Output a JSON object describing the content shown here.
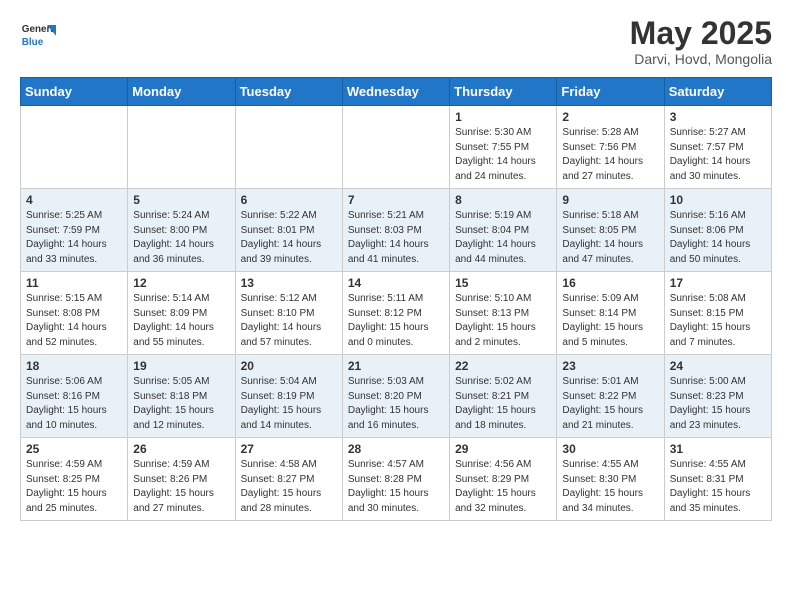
{
  "header": {
    "logo_general": "General",
    "logo_blue": "Blue",
    "title": "May 2025",
    "location": "Darvi, Hovd, Mongolia"
  },
  "weekdays": [
    "Sunday",
    "Monday",
    "Tuesday",
    "Wednesday",
    "Thursday",
    "Friday",
    "Saturday"
  ],
  "weeks": [
    [
      {
        "day": "",
        "sunrise": "",
        "sunset": "",
        "daylight": ""
      },
      {
        "day": "",
        "sunrise": "",
        "sunset": "",
        "daylight": ""
      },
      {
        "day": "",
        "sunrise": "",
        "sunset": "",
        "daylight": ""
      },
      {
        "day": "",
        "sunrise": "",
        "sunset": "",
        "daylight": ""
      },
      {
        "day": "1",
        "sunrise": "Sunrise: 5:30 AM",
        "sunset": "Sunset: 7:55 PM",
        "daylight": "Daylight: 14 hours and 24 minutes."
      },
      {
        "day": "2",
        "sunrise": "Sunrise: 5:28 AM",
        "sunset": "Sunset: 7:56 PM",
        "daylight": "Daylight: 14 hours and 27 minutes."
      },
      {
        "day": "3",
        "sunrise": "Sunrise: 5:27 AM",
        "sunset": "Sunset: 7:57 PM",
        "daylight": "Daylight: 14 hours and 30 minutes."
      }
    ],
    [
      {
        "day": "4",
        "sunrise": "Sunrise: 5:25 AM",
        "sunset": "Sunset: 7:59 PM",
        "daylight": "Daylight: 14 hours and 33 minutes."
      },
      {
        "day": "5",
        "sunrise": "Sunrise: 5:24 AM",
        "sunset": "Sunset: 8:00 PM",
        "daylight": "Daylight: 14 hours and 36 minutes."
      },
      {
        "day": "6",
        "sunrise": "Sunrise: 5:22 AM",
        "sunset": "Sunset: 8:01 PM",
        "daylight": "Daylight: 14 hours and 39 minutes."
      },
      {
        "day": "7",
        "sunrise": "Sunrise: 5:21 AM",
        "sunset": "Sunset: 8:03 PM",
        "daylight": "Daylight: 14 hours and 41 minutes."
      },
      {
        "day": "8",
        "sunrise": "Sunrise: 5:19 AM",
        "sunset": "Sunset: 8:04 PM",
        "daylight": "Daylight: 14 hours and 44 minutes."
      },
      {
        "day": "9",
        "sunrise": "Sunrise: 5:18 AM",
        "sunset": "Sunset: 8:05 PM",
        "daylight": "Daylight: 14 hours and 47 minutes."
      },
      {
        "day": "10",
        "sunrise": "Sunrise: 5:16 AM",
        "sunset": "Sunset: 8:06 PM",
        "daylight": "Daylight: 14 hours and 50 minutes."
      }
    ],
    [
      {
        "day": "11",
        "sunrise": "Sunrise: 5:15 AM",
        "sunset": "Sunset: 8:08 PM",
        "daylight": "Daylight: 14 hours and 52 minutes."
      },
      {
        "day": "12",
        "sunrise": "Sunrise: 5:14 AM",
        "sunset": "Sunset: 8:09 PM",
        "daylight": "Daylight: 14 hours and 55 minutes."
      },
      {
        "day": "13",
        "sunrise": "Sunrise: 5:12 AM",
        "sunset": "Sunset: 8:10 PM",
        "daylight": "Daylight: 14 hours and 57 minutes."
      },
      {
        "day": "14",
        "sunrise": "Sunrise: 5:11 AM",
        "sunset": "Sunset: 8:12 PM",
        "daylight": "Daylight: 15 hours and 0 minutes."
      },
      {
        "day": "15",
        "sunrise": "Sunrise: 5:10 AM",
        "sunset": "Sunset: 8:13 PM",
        "daylight": "Daylight: 15 hours and 2 minutes."
      },
      {
        "day": "16",
        "sunrise": "Sunrise: 5:09 AM",
        "sunset": "Sunset: 8:14 PM",
        "daylight": "Daylight: 15 hours and 5 minutes."
      },
      {
        "day": "17",
        "sunrise": "Sunrise: 5:08 AM",
        "sunset": "Sunset: 8:15 PM",
        "daylight": "Daylight: 15 hours and 7 minutes."
      }
    ],
    [
      {
        "day": "18",
        "sunrise": "Sunrise: 5:06 AM",
        "sunset": "Sunset: 8:16 PM",
        "daylight": "Daylight: 15 hours and 10 minutes."
      },
      {
        "day": "19",
        "sunrise": "Sunrise: 5:05 AM",
        "sunset": "Sunset: 8:18 PM",
        "daylight": "Daylight: 15 hours and 12 minutes."
      },
      {
        "day": "20",
        "sunrise": "Sunrise: 5:04 AM",
        "sunset": "Sunset: 8:19 PM",
        "daylight": "Daylight: 15 hours and 14 minutes."
      },
      {
        "day": "21",
        "sunrise": "Sunrise: 5:03 AM",
        "sunset": "Sunset: 8:20 PM",
        "daylight": "Daylight: 15 hours and 16 minutes."
      },
      {
        "day": "22",
        "sunrise": "Sunrise: 5:02 AM",
        "sunset": "Sunset: 8:21 PM",
        "daylight": "Daylight: 15 hours and 18 minutes."
      },
      {
        "day": "23",
        "sunrise": "Sunrise: 5:01 AM",
        "sunset": "Sunset: 8:22 PM",
        "daylight": "Daylight: 15 hours and 21 minutes."
      },
      {
        "day": "24",
        "sunrise": "Sunrise: 5:00 AM",
        "sunset": "Sunset: 8:23 PM",
        "daylight": "Daylight: 15 hours and 23 minutes."
      }
    ],
    [
      {
        "day": "25",
        "sunrise": "Sunrise: 4:59 AM",
        "sunset": "Sunset: 8:25 PM",
        "daylight": "Daylight: 15 hours and 25 minutes."
      },
      {
        "day": "26",
        "sunrise": "Sunrise: 4:59 AM",
        "sunset": "Sunset: 8:26 PM",
        "daylight": "Daylight: 15 hours and 27 minutes."
      },
      {
        "day": "27",
        "sunrise": "Sunrise: 4:58 AM",
        "sunset": "Sunset: 8:27 PM",
        "daylight": "Daylight: 15 hours and 28 minutes."
      },
      {
        "day": "28",
        "sunrise": "Sunrise: 4:57 AM",
        "sunset": "Sunset: 8:28 PM",
        "daylight": "Daylight: 15 hours and 30 minutes."
      },
      {
        "day": "29",
        "sunrise": "Sunrise: 4:56 AM",
        "sunset": "Sunset: 8:29 PM",
        "daylight": "Daylight: 15 hours and 32 minutes."
      },
      {
        "day": "30",
        "sunrise": "Sunrise: 4:55 AM",
        "sunset": "Sunset: 8:30 PM",
        "daylight": "Daylight: 15 hours and 34 minutes."
      },
      {
        "day": "31",
        "sunrise": "Sunrise: 4:55 AM",
        "sunset": "Sunset: 8:31 PM",
        "daylight": "Daylight: 15 hours and 35 minutes."
      }
    ]
  ]
}
